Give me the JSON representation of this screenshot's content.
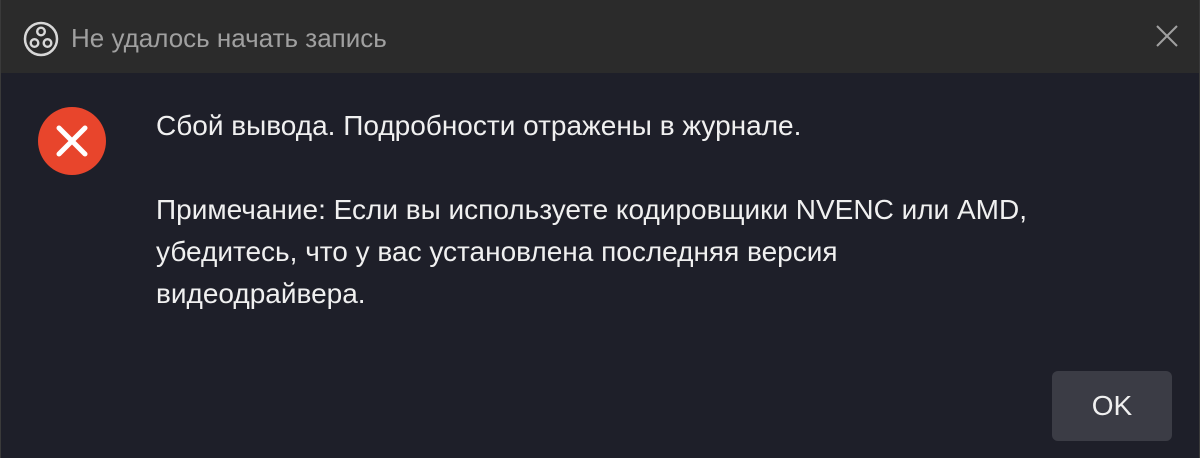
{
  "window": {
    "title": "Не удалось начать запись",
    "app_icon": "obs-logo-icon",
    "close_icon": "close-icon"
  },
  "dialog": {
    "icon": "error-icon",
    "message_line1": "Сбой вывода. Подробности отражены в журнале.",
    "note_line1": "Примечание: Если вы используете кодировщики NVENC или AMD,",
    "note_line2": "убедитесь, что у вас установлена последняя версия",
    "note_line3": "видеодрайвера.",
    "ok_label": "OK"
  },
  "colors": {
    "background": "#1e1f29",
    "titlebar": "#2b2b2b",
    "error_red": "#e8452c",
    "button": "#3b3c45"
  }
}
